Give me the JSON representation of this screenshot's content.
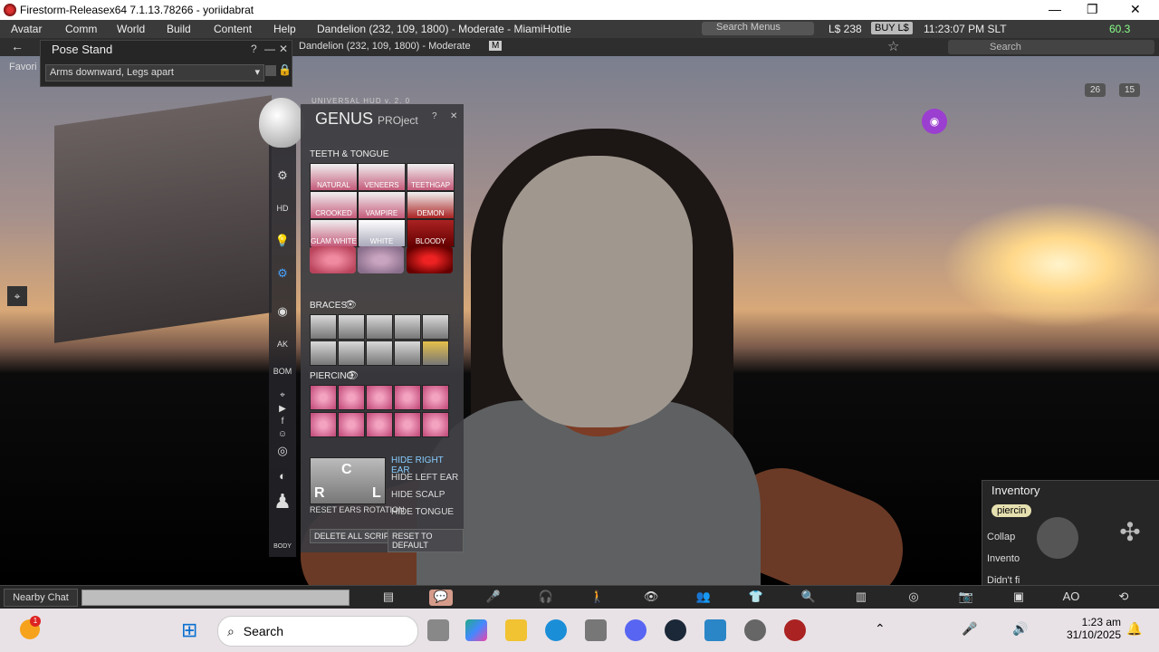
{
  "titlebar": {
    "title": "Firestorm-Releasex64 7.1.13.78266 - yoriidabrat",
    "minimize": "—",
    "maximize": "❐",
    "close": "✕"
  },
  "menubar": {
    "items": [
      "Avatar",
      "Comm",
      "World",
      "Build",
      "Content",
      "Help"
    ],
    "parcel": "Dandelion (232, 109, 1800) - Moderate - MiamiHottie",
    "search_placeholder": "Search Menus",
    "balance": "L$ 238",
    "buy": "BUY L$",
    "time": "11:23:07 PM SLT",
    "fps": "60.3"
  },
  "navbar": {
    "location": "Dandelion (232, 109, 1800) - Moderate",
    "rating_badge": "M",
    "search_placeholder": "Search",
    "favorites": "Favori"
  },
  "pose_stand": {
    "title": "Pose Stand",
    "help": "?",
    "minimize": "—",
    "close": "✕",
    "selected": "Arms downward, Legs apart"
  },
  "hud": {
    "subtitle": "UNIVERSAL HUD v. 2. 0",
    "brand": "GENUS",
    "brand_suffix": "PROject",
    "help": "?",
    "close": "✕",
    "teeth_title": "TEETH & TONGUE",
    "teeth": [
      "NATURAL",
      "VENEERS",
      "TEETHGAP",
      "CROOKED",
      "VAMPIRE",
      "DEMON",
      "GLAM WHITE",
      "WHITE",
      "BLOODY"
    ],
    "braces_title": "BRACES",
    "piercing_title": "PIERCING",
    "hide_right_ear": "HIDE RIGHT EAR",
    "hide_left_ear": "HIDE LEFT EAR",
    "hide_scalp": "HIDE SCALP",
    "hide_tongue": "HIDE TONGUE",
    "reset_ears": "RESET EARS ROTATION",
    "ear_r": "R",
    "ear_l": "L",
    "ear_c": "C",
    "delete_scripts": "DELETE ALL SCRIPTS",
    "reset_default": "RESET TO DEFAULT",
    "side_labels": {
      "hd": "HD",
      "ak": "AK",
      "bom": "BOM",
      "body": "BODY"
    }
  },
  "overlay": {
    "count_a": "26",
    "count_b": "15"
  },
  "inventory": {
    "title": "Inventory",
    "filter": "piercin",
    "collapse": "Collap",
    "inventory_label": "Invento",
    "didnt_find": "Didn't fi"
  },
  "chat": {
    "nearby": "Nearby Chat"
  },
  "toolbar": {
    "ao": "AO"
  },
  "taskbar": {
    "search": "Search",
    "time": "1:23 am",
    "date": "31/10/2025",
    "notif": "1"
  }
}
